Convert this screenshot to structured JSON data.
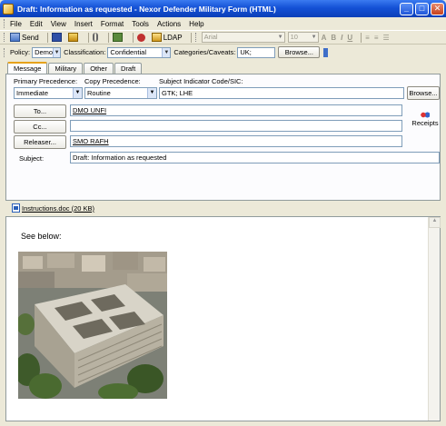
{
  "window": {
    "title": "Draft: Information as requested - Nexor Defender Military Form (HTML)",
    "controls": [
      "_",
      "□",
      "✕"
    ]
  },
  "menu": [
    "File",
    "Edit",
    "View",
    "Insert",
    "Format",
    "Tools",
    "Actions",
    "Help"
  ],
  "toolbar": {
    "send_label": "Send",
    "ldap_label": "LDAP",
    "font_name": "Arial",
    "font_size": "10",
    "format_buttons": [
      "A",
      "B",
      "I",
      "U"
    ]
  },
  "policy": {
    "policy_label": "Policy:",
    "policy_value": "Demo",
    "classification_label": "Classification:",
    "classification_value": "Confidential",
    "categories_label": "Categories/Caveats:",
    "categories_value": "UK;",
    "browse_label": "Browse..."
  },
  "tabs": [
    {
      "label": "Message",
      "active": true
    },
    {
      "label": "Military",
      "active": false
    },
    {
      "label": "Other",
      "active": false
    },
    {
      "label": "Draft",
      "active": false
    }
  ],
  "message": {
    "primary_precedence_label": "Primary Precedence:",
    "primary_precedence_value": "Immediate",
    "copy_precedence_label": "Copy Precedence:",
    "copy_precedence_value": "Routine",
    "sic_label": "Subject Indicator Code/SIC:",
    "sic_value": "GTK; LHE",
    "browse_label": "Browse...",
    "to_label": "To...",
    "to_value": "DMO UNFI",
    "cc_label": "Cc...",
    "cc_value": "",
    "releaser_label": "Releaser...",
    "releaser_value": "SMO RAFH",
    "receipts_label": "Receipts",
    "subject_label": "Subject:",
    "subject_value": "Draft: Information as requested"
  },
  "attachment": {
    "name": "Instructions.doc (20 KB)"
  },
  "body": {
    "text": "See below:"
  }
}
